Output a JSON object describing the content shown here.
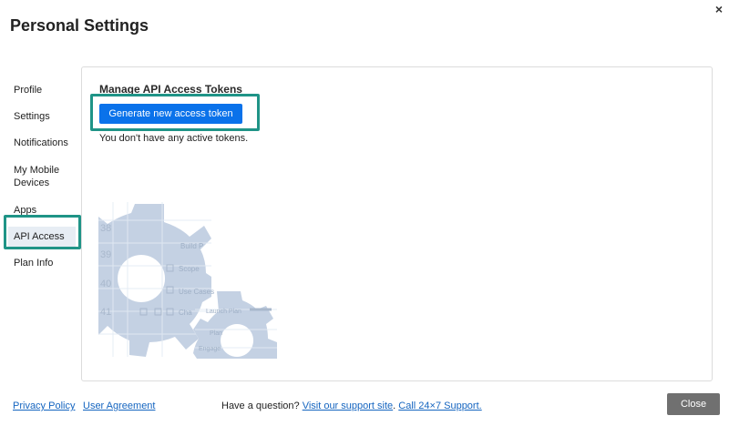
{
  "window": {
    "title": "Personal Settings",
    "close_glyph": "×"
  },
  "sidebar": {
    "items": [
      {
        "label": "Profile"
      },
      {
        "label": "Settings"
      },
      {
        "label": "Notifications"
      },
      {
        "label": "My Mobile Devices"
      },
      {
        "label": "Apps"
      },
      {
        "label": "API Access",
        "active": true
      },
      {
        "label": "Plan Info"
      }
    ]
  },
  "main": {
    "heading": "Manage API Access Tokens",
    "generate_button": "Generate new access token",
    "empty_message": "You don't have any active tokens.",
    "illustration": {
      "row_numbers": [
        "38",
        "39",
        "40",
        "41"
      ],
      "row_labels": [
        "Build P",
        "Scope",
        "Use Cases",
        "Cha",
        "Launch Plan",
        "Plan",
        "Engage"
      ]
    }
  },
  "footer": {
    "privacy_link": "Privacy Policy",
    "agreement_link": "User Agreement",
    "question_text": "Have a question?",
    "support_link": "Visit our support site",
    "separator": ".",
    "phone_link": "Call 24×7 Support.",
    "close_button": "Close"
  },
  "colors": {
    "primary_button": "#0a72ea",
    "highlight_border": "#1f9487",
    "active_nav_bg": "#e7edf4",
    "link": "#1565c0",
    "close_button_bg": "#707070"
  }
}
